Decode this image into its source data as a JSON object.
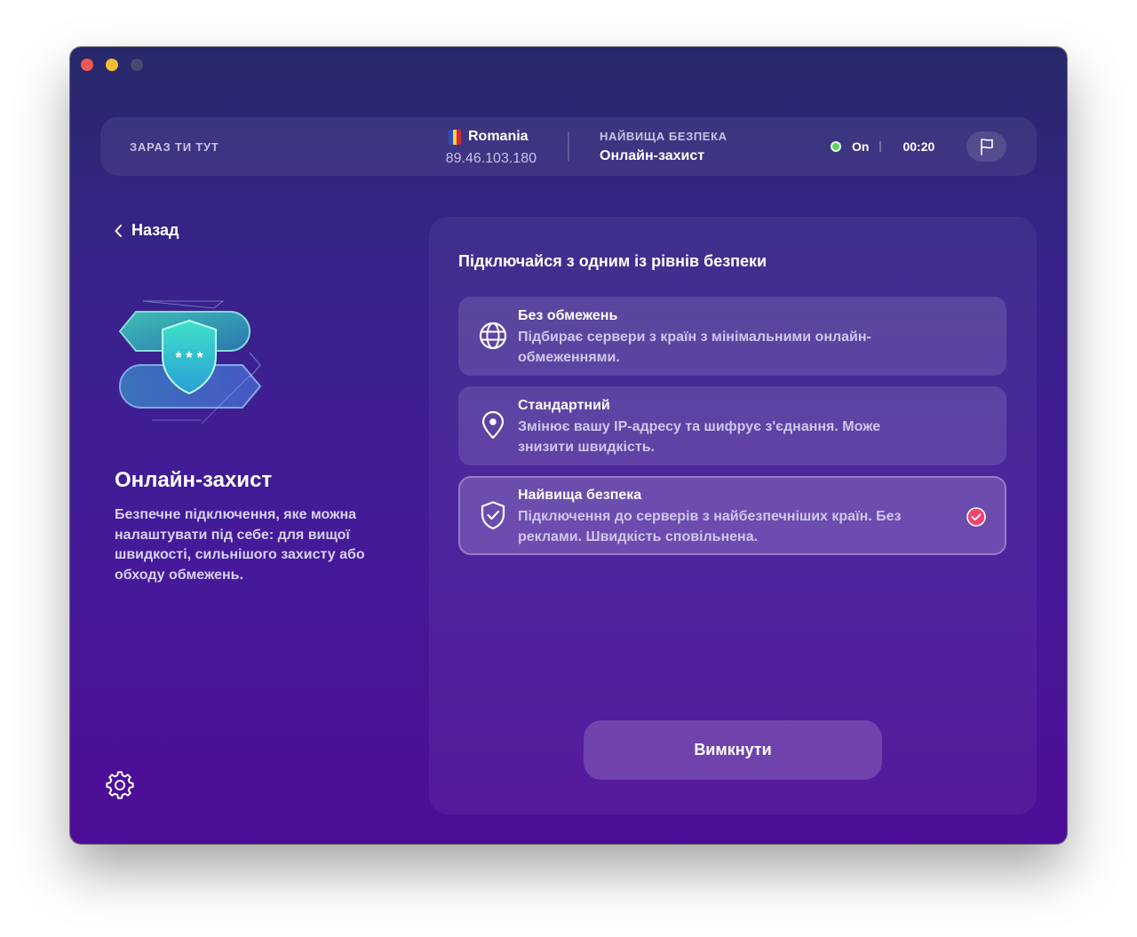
{
  "header": {
    "location_label": "ЗАРАЗ ТИ ТУТ",
    "country": "Romania",
    "country_flag_colors": [
      "#2e4bb8",
      "#f6d23c",
      "#d4283c"
    ],
    "ip": "89.46.103.180",
    "security_label": "НАЙВИЩА БЕЗПЕКА",
    "security_value": "Онлайн-захист",
    "status_text": "On",
    "status_color": "#5cd35c",
    "timer": "00:20",
    "report_icon": "flag-icon"
  },
  "sidebar": {
    "back_label": "Назад",
    "title": "Онлайн-захист",
    "description": "Безпечне підключення, яке можна налаштувати під себе: для вищої швидкості, сильнішого захисту або обходу обмежень.",
    "settings_icon": "gear-icon"
  },
  "panel": {
    "title": "Підключайся з одним із рівнів безпеки",
    "options": [
      {
        "icon": "globe-icon",
        "title": "Без обмежень",
        "description": "Підбирає сервери з країн з мінімальними онлайн-обмеженнями.",
        "selected": false
      },
      {
        "icon": "location-pin-icon",
        "title": "Стандартний",
        "description": "Змінює вашу IP-адресу та шифрує з'єднання. Може знизити швидкість.",
        "selected": false
      },
      {
        "icon": "shield-check-icon",
        "title": "Найвища безпека",
        "description": "Підключення до серверів з найбезпечніших країн. Без реклами. Швидкість сповільнена.",
        "selected": true
      }
    ],
    "button_label": "Вимкнути"
  },
  "colors": {
    "accent_check": "#f0436f",
    "background_top": "#27286a",
    "background_bottom": "#4d0d96"
  }
}
